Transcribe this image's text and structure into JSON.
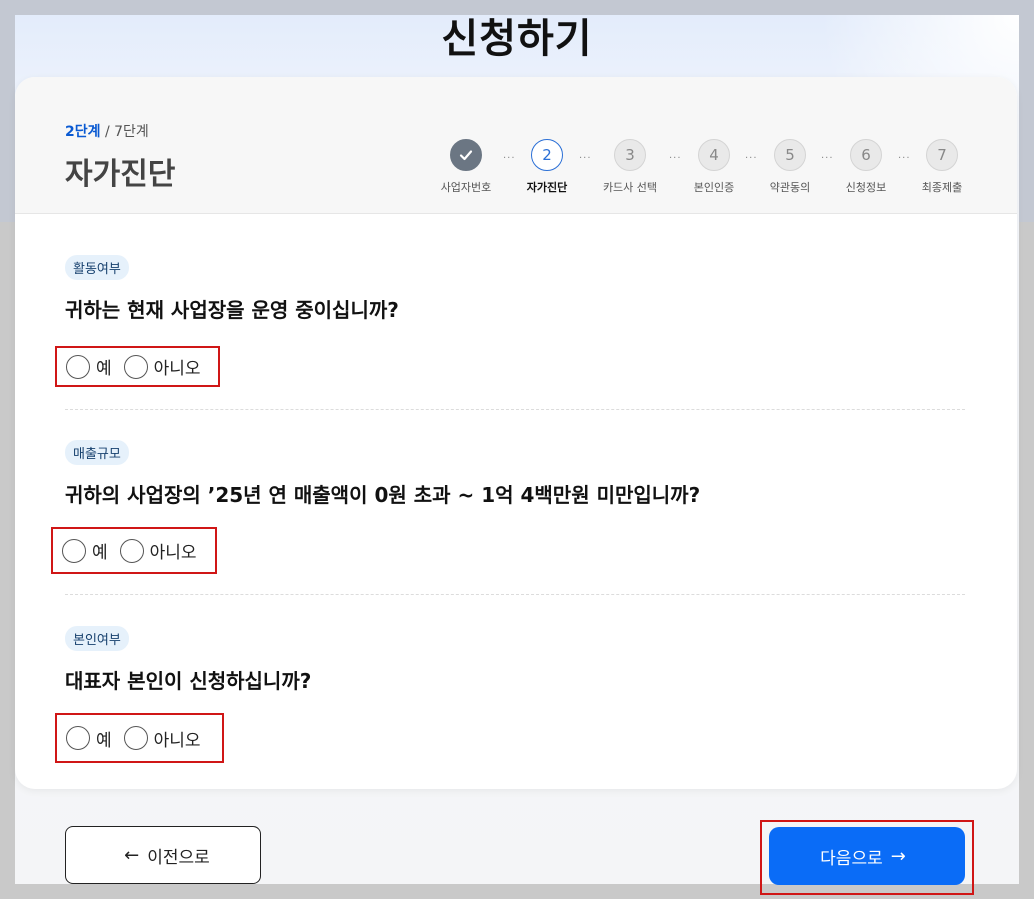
{
  "page": {
    "title": "신청하기"
  },
  "progress": {
    "current": "2단계",
    "separator": " / ",
    "total": "7단계",
    "title": "자가진단"
  },
  "stepper": {
    "steps": [
      {
        "number": "",
        "label": "사업자번호",
        "state": "done"
      },
      {
        "number": "2",
        "label": "자가진단",
        "state": "active"
      },
      {
        "number": "3",
        "label": "카드사 선택",
        "state": "pending"
      },
      {
        "number": "4",
        "label": "본인인증",
        "state": "pending"
      },
      {
        "number": "5",
        "label": "약관동의",
        "state": "pending"
      },
      {
        "number": "6",
        "label": "신청정보",
        "state": "pending"
      },
      {
        "number": "7",
        "label": "최종제출",
        "state": "pending"
      }
    ],
    "separator": "···"
  },
  "questions": [
    {
      "tag": "활동여부",
      "text": "귀하는 현재 사업장을 운영 중이십니까?",
      "yes": "예",
      "no": "아니오"
    },
    {
      "tag": "매출규모",
      "text": "귀하의 사업장의 ’25년 연 매출액이 0원 초과 ~ 1억 4백만원 미만입니까?",
      "yes": "예",
      "no": "아니오"
    },
    {
      "tag": "본인여부",
      "text": "대표자 본인이 신청하십니까?",
      "yes": "예",
      "no": "아니오"
    }
  ],
  "buttons": {
    "prev": "이전으로",
    "next": "다음으로"
  },
  "colors": {
    "primary": "#0a6cf7",
    "accent_text": "#0a5ad2",
    "highlight": "#d01616",
    "done_step": "#6b7683"
  }
}
